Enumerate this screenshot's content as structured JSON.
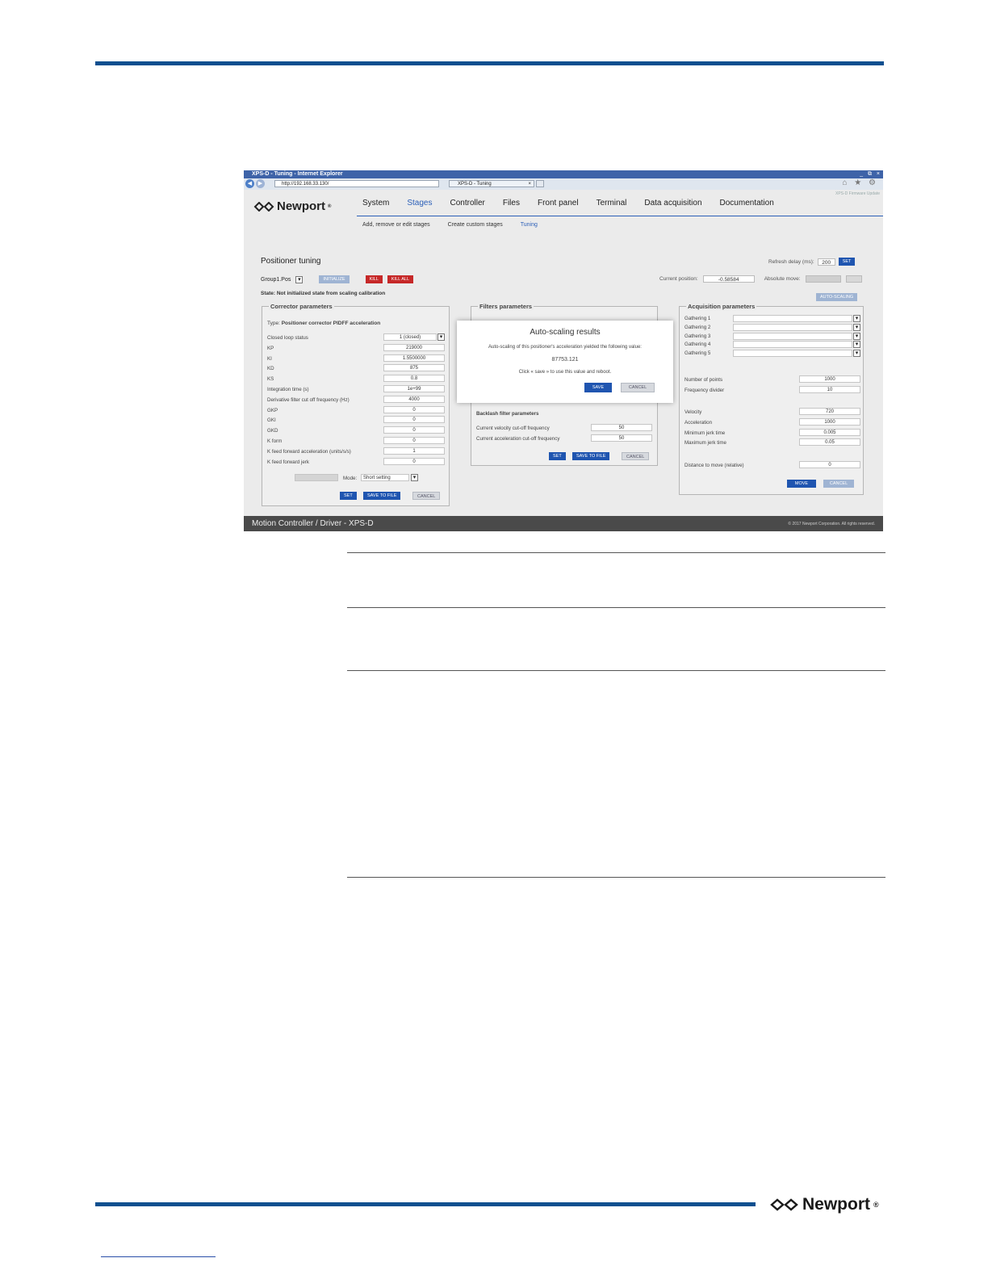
{
  "browser": {
    "title": "XPS-D - Tuning - Internet Explorer",
    "window_buttons": "_ ⧉ ×",
    "url": "http://192.168.33.130/",
    "tab_title": "XPS-D - Tuning",
    "tab_close": "×",
    "tools": "⌂ ★ ⚙"
  },
  "app": {
    "brand": "Newport",
    "brand_mark": "®",
    "header_link": "XPS-D Firmware Update",
    "nav": [
      "System",
      "Stages",
      "Controller",
      "Files",
      "Front panel",
      "Terminal",
      "Data acquisition",
      "Documentation"
    ],
    "subnav": [
      "Add, remove or edit stages",
      "Create custom stages",
      "Tuning"
    ]
  },
  "tuning": {
    "title": "Positioner tuning",
    "refresh_label": "Refresh delay (ms):",
    "refresh_value": "200",
    "set": "SET",
    "group": "Group1.Pos",
    "initialize": "INITIALIZE",
    "kill": "KILL",
    "kill_all": "KILL ALL",
    "current_position_label": "Current position:",
    "current_position": "-0.58584",
    "absolute_move_label": "Absolute move:",
    "auto_scaling": "AUTO-SCALING",
    "state": "State: Not initialized state from scaling calibration"
  },
  "corrector": {
    "title": "Corrector parameters",
    "type_label": "Type:",
    "type_value": "Positioner corrector PIDFF acceleration",
    "rows": [
      {
        "label": "Closed loop status",
        "value": "1 (closed)"
      },
      {
        "label": "KP",
        "value": "219000"
      },
      {
        "label": "KI",
        "value": "1.5500000"
      },
      {
        "label": "KD",
        "value": "875"
      },
      {
        "label": "KS",
        "value": "0.8"
      },
      {
        "label": "Integration time (s)",
        "value": "1e+99"
      },
      {
        "label": "Derivative filter cut off frequency (Hz)",
        "value": "4000"
      },
      {
        "label": "GKP",
        "value": "0"
      },
      {
        "label": "GKI",
        "value": "0"
      },
      {
        "label": "GKD",
        "value": "0"
      },
      {
        "label": "K form",
        "value": "0"
      },
      {
        "label": "K feed forward acceleration (units/s/s)",
        "value": "1"
      },
      {
        "label": "K feed forward jerk",
        "value": "0"
      }
    ],
    "mode_label": "Mode:",
    "mode_value": "Short setting",
    "set": "SET",
    "save_to_file": "SAVE TO FILE",
    "cancel": "CANCEL"
  },
  "filters": {
    "title": "Filters parameters",
    "backlash_title": "Backlash filter parameters",
    "rows": [
      {
        "label": "Current velocity cut-off frequency",
        "value": "50"
      },
      {
        "label": "Current acceleration cut-off frequency",
        "value": "50"
      }
    ],
    "set": "SET",
    "save_to_file": "SAVE TO FILE",
    "cancel": "CANCEL"
  },
  "acquisition": {
    "title": "Acquisition parameters",
    "gathering": [
      "Gathering 1",
      "Gathering 2",
      "Gathering 3",
      "Gathering 4",
      "Gathering 5"
    ],
    "rows1": [
      {
        "label": "Number of points",
        "value": "1000"
      },
      {
        "label": "Frequency divider",
        "value": "10"
      }
    ],
    "rows2": [
      {
        "label": "Velocity",
        "value": "720"
      },
      {
        "label": "Acceleration",
        "value": "1000"
      },
      {
        "label": "Minimum jerk time",
        "value": "0.005"
      },
      {
        "label": "Maximum jerk time",
        "value": "0.05"
      }
    ],
    "distance_label": "Distance to move (relative)",
    "distance_value": "0",
    "move": "MOVE",
    "cancel": "CANCEL"
  },
  "modal": {
    "title": "Auto-scaling results",
    "message": "Auto-scaling of this positioner's acceleration yielded the following value:",
    "value": "87753.121",
    "hint": "Click « save » to use this value and reboot.",
    "save": "SAVE",
    "cancel": "CANCEL"
  },
  "footer": {
    "left": "Motion Controller / Driver - XPS-D",
    "right": "© 2017 Newport Corporation. All rights reserved."
  },
  "page": {
    "logo": "Newport",
    "logo_mark": "®"
  }
}
